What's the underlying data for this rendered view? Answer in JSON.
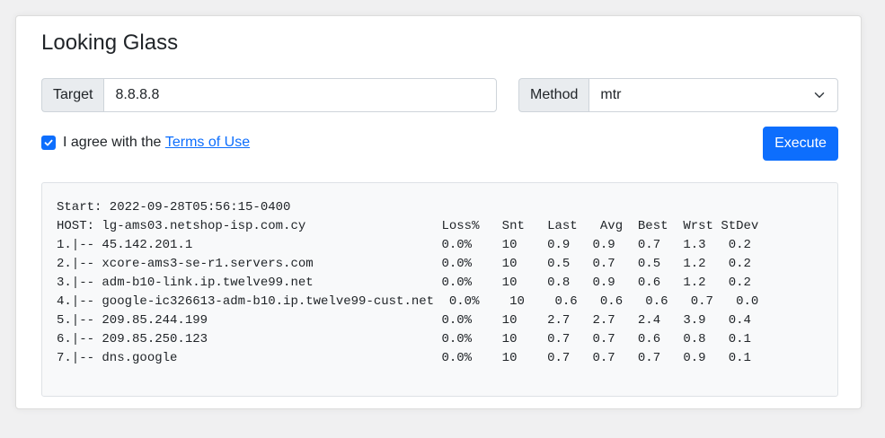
{
  "app": {
    "title": "Looking Glass"
  },
  "form": {
    "target_label": "Target",
    "target_value": "8.8.8.8",
    "method_label": "Method",
    "method_value": "mtr",
    "agree_prefix": "I agree with the ",
    "agree_link": "Terms of Use",
    "agree_checked": true,
    "execute_label": "Execute"
  },
  "output": {
    "lines": [
      "Start: 2022-09-28T05:56:15-0400",
      "HOST: lg-ams03.netshop-isp.com.cy                  Loss%   Snt   Last   Avg  Best  Wrst StDev",
      "1.|-- 45.142.201.1                                 0.0%    10    0.9   0.9   0.7   1.3   0.2",
      "2.|-- xcore-ams3-se-r1.servers.com                 0.0%    10    0.5   0.7   0.5   1.2   0.2",
      "3.|-- adm-b10-link.ip.twelve99.net                 0.0%    10    0.8   0.9   0.6   1.2   0.2",
      "4.|-- google-ic326613-adm-b10.ip.twelve99-cust.net  0.0%    10    0.6   0.6   0.6   0.7   0.0",
      "5.|-- 209.85.244.199                               0.0%    10    2.7   2.7   2.4   3.9   0.4",
      "6.|-- 209.85.250.123                               0.0%    10    0.7   0.7   0.6   0.8   0.1",
      "7.|-- dns.google                                   0.0%    10    0.7   0.7   0.7   0.9   0.1"
    ]
  },
  "colors": {
    "primary": "#0d6efd",
    "addon_bg": "#e9ecef",
    "output_bg": "#f8f9fa"
  },
  "icons": {
    "select": "chevron-down-icon",
    "checkbox": "check-icon"
  }
}
